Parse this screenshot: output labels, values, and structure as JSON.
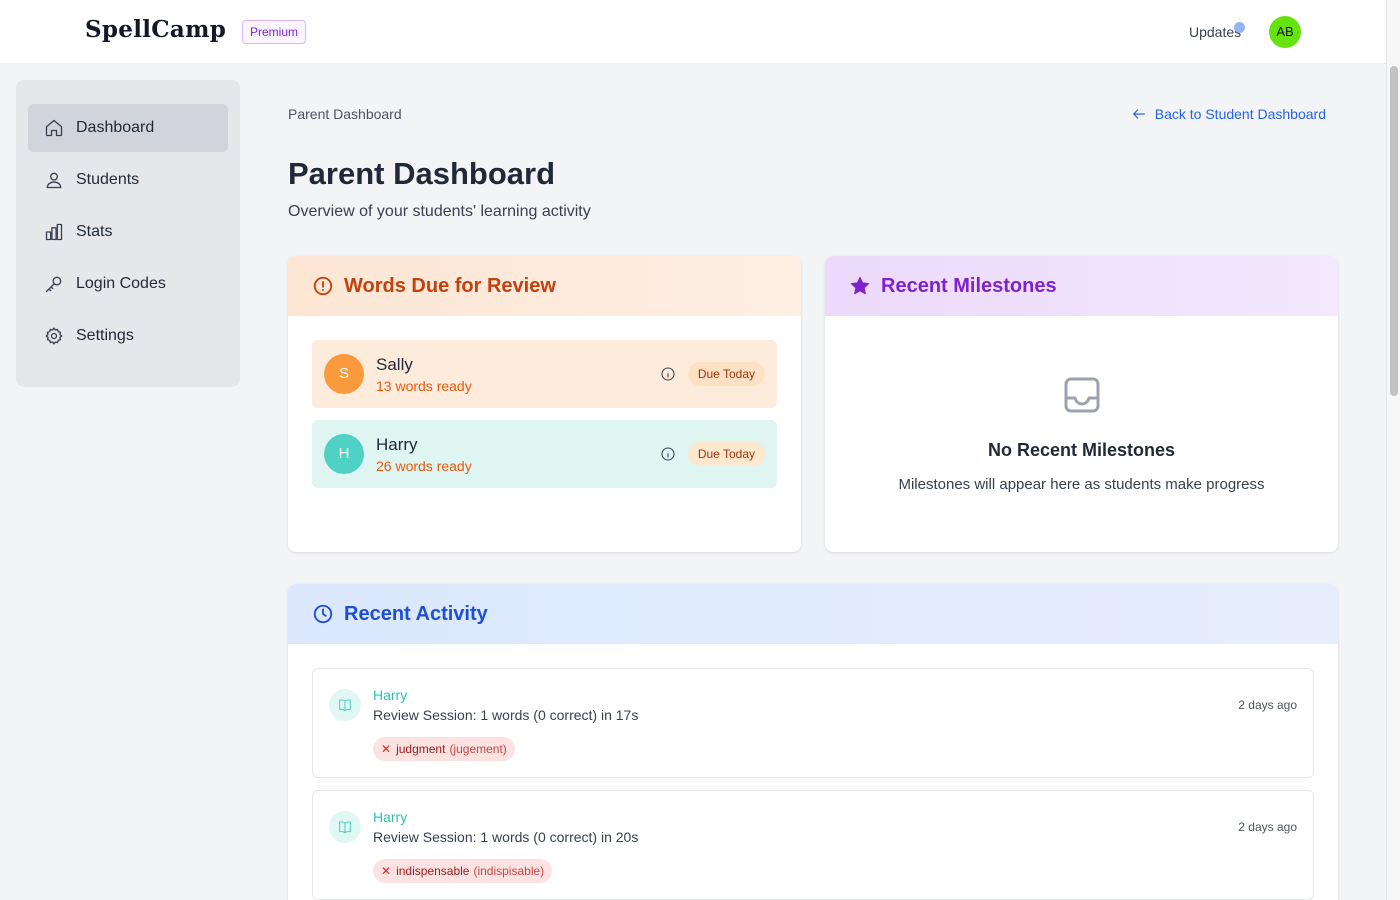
{
  "header": {
    "logo": "SpellCamp",
    "plan_badge": "Premium",
    "updates_label": "Updates",
    "avatar_initials": "AB",
    "avatar_color": "#66e30f"
  },
  "sidebar": {
    "items": [
      {
        "label": "Dashboard",
        "icon": "home-icon",
        "active": true
      },
      {
        "label": "Students",
        "icon": "users-icon"
      },
      {
        "label": "Stats",
        "icon": "bar-chart-icon"
      },
      {
        "label": "Login Codes",
        "icon": "key-icon"
      },
      {
        "label": "Settings",
        "icon": "gear-icon"
      }
    ]
  },
  "main": {
    "breadcrumb": "Parent Dashboard",
    "back_link": "Back to Student Dashboard",
    "title": "Parent Dashboard",
    "subtitle": "Overview of your students' learning activity"
  },
  "review_card": {
    "title": "Words Due for Review",
    "students": [
      {
        "initial": "S",
        "name": "Sally",
        "words": "13 words ready",
        "due": "Due Today"
      },
      {
        "initial": "H",
        "name": "Harry",
        "words": "26 words ready",
        "due": "Due Today"
      }
    ]
  },
  "milestones_card": {
    "title": "Recent Milestones",
    "empty_title": "No Recent Milestones",
    "empty_subtitle": "Milestones will appear here as students make progress"
  },
  "activity_card": {
    "title": "Recent Activity",
    "items": [
      {
        "student": "Harry",
        "description": "Review Session: 1 words (0 correct) in 17s",
        "time": "2 days ago",
        "word": "judgment",
        "attempt": "(jugement)"
      },
      {
        "student": "Harry",
        "description": "Review Session: 1 words (0 correct) in 20s",
        "time": "2 days ago",
        "word": "indispensable",
        "attempt": "(indispisable)"
      }
    ]
  },
  "colors": {
    "accent_blue": "#2563eb",
    "review_orange": "#c2410c",
    "milestone_purple": "#7e22ce",
    "activity_blue": "#1d4ed8",
    "teal": "#4fd1c5"
  }
}
